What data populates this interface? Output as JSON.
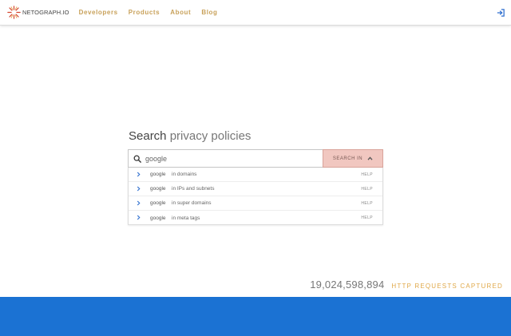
{
  "brand": {
    "logo_text": "NETOGRAPH.IO",
    "accent": "#c8a15a",
    "icon": "starburst-logo-icon"
  },
  "nav": {
    "items": [
      "Developers",
      "Products",
      "About",
      "Blog"
    ],
    "login_icon": "login-icon"
  },
  "headline": {
    "strong": "Search",
    "light": "privacy policies"
  },
  "search": {
    "value": "google",
    "icon": "search-icon",
    "button_label": "SEARCH IN",
    "button_color": "#f1c7c0"
  },
  "suggestions": [
    {
      "query": "google",
      "scope": "in domains",
      "help": "HELP"
    },
    {
      "query": "google",
      "scope": "in IPs and subnets",
      "help": "HELP"
    },
    {
      "query": "google",
      "scope": "in super domains",
      "help": "HELP"
    },
    {
      "query": "google",
      "scope": "in meta tags",
      "help": "HELP"
    }
  ],
  "stats": {
    "count": "19,024,598,894",
    "label": "HTTP REQUESTS CAPTURED",
    "label_color": "#e0a94a"
  },
  "footer": {
    "color": "#1b72d3"
  }
}
